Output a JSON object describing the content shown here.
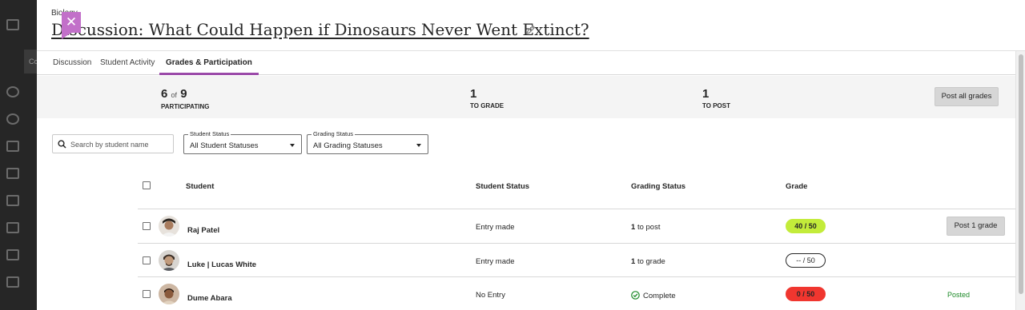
{
  "background": {
    "nav_strip_label": "Co"
  },
  "panel": {
    "close_label": "✕",
    "course_name": "Biology",
    "title": "Discussion: What Could Happen if Dinosaurs Never Went Extinct?"
  },
  "tabs": [
    {
      "label": "Discussion",
      "active": false
    },
    {
      "label": "Student Activity",
      "active": false
    },
    {
      "label": "Grades & Participation",
      "active": true
    }
  ],
  "summary": {
    "participating": {
      "count": "6",
      "of_word": "of",
      "total": "9",
      "label": "PARTICIPATING"
    },
    "to_grade": {
      "count": "1",
      "label": "TO GRADE"
    },
    "to_post": {
      "count": "1",
      "label": "TO POST"
    },
    "post_all_label": "Post all grades"
  },
  "filters": {
    "search_placeholder": "Search by student name",
    "student_status": {
      "legend": "Student Status",
      "value": "All Student Statuses"
    },
    "grading_status": {
      "legend": "Grading Status",
      "value": "All Grading Statuses"
    }
  },
  "table": {
    "headers": {
      "student": "Student",
      "student_status": "Student Status",
      "grading_status": "Grading Status",
      "grade": "Grade"
    },
    "rows": [
      {
        "name": "Raj Patel",
        "student_status": "Entry made",
        "grading_count": "1",
        "grading_text": "to post",
        "grade_text": "40  / 50",
        "grade_style": "green",
        "action": "Post 1 grade"
      },
      {
        "name": "Luke | Lucas White",
        "student_status": "Entry made",
        "grading_count": "1",
        "grading_text": "to grade",
        "grade_text": "--  / 50",
        "grade_style": "empty"
      },
      {
        "name": "Dume Abara",
        "student_status": "No Entry",
        "grading_text": "Complete",
        "grade_text": "0  / 50",
        "grade_style": "red",
        "posted": "Posted"
      }
    ]
  },
  "colors": {
    "accent": "#9b4aa9",
    "close_bg": "#c270c9",
    "grade_green": "#c3ec3a",
    "grade_red": "#f0362f",
    "posted_green": "#1d8a28"
  }
}
